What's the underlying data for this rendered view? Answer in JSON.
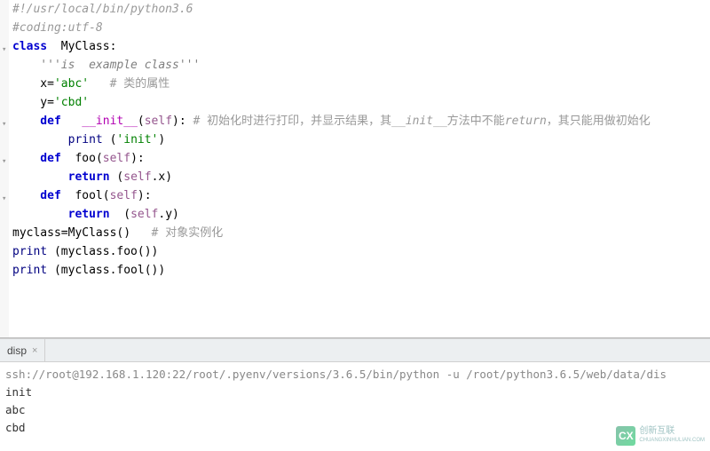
{
  "code": {
    "l1_shebang": "#!/usr/local/bin/python3.6",
    "l2_coding": "#coding:utf-8",
    "l3_class_kw": "class",
    "l3_class_name": "  MyClass:",
    "l4_docstring": "    '''is  example class'''",
    "l5_indent": "    x=",
    "l5_str": "'abc'",
    "l5_comment": "   # 类的属性",
    "l6_indent": "    y=",
    "l6_str": "'cbd'",
    "l7_def": "    def",
    "l7_name": "   __init__",
    "l7_paren_open": "(",
    "l7_self": "self",
    "l7_paren_close": "): ",
    "l7_comment_a": "# 初始化时进行打印，并显示结果，其",
    "l7_comment_b": "__init__",
    "l7_comment_c": "方法中不能",
    "l7_comment_d": "return",
    "l7_comment_e": "，其只能用做初始化",
    "l8_indent": "        ",
    "l8_print": "print ",
    "l8_paren_open": "(",
    "l8_str": "'init'",
    "l8_paren_close": ")",
    "l9_def": "    def",
    "l9_name": "  foo",
    "l9_paren_open": "(",
    "l9_self": "self",
    "l9_paren_close": "):",
    "l10_indent": "        ",
    "l10_return": "return",
    "l10_open": " (",
    "l10_self": "self",
    "l10_attr": ".x)",
    "l11_def": "    def",
    "l11_name": "  fool",
    "l11_paren_open": "(",
    "l11_self": "self",
    "l11_paren_close": "):",
    "l12_indent": "        ",
    "l12_return": "return",
    "l12_open": "  (",
    "l12_self": "self",
    "l12_attr": ".y)",
    "l13_a": "myclass=MyClass()   ",
    "l13_comment": "# 对象实例化",
    "l14_print": "print ",
    "l14_rest": "(myclass.foo())",
    "l15_print": "print ",
    "l15_rest": "(myclass.fool())"
  },
  "tab": {
    "name": "disp",
    "close": "×"
  },
  "console": {
    "ssh": "ssh://root@192.168.1.120:22/root/.pyenv/versions/3.6.5/bin/python -u /root/python3.6.5/web/data/dis",
    "out1": "init",
    "out2": "abc",
    "out3": "cbd"
  },
  "watermark": {
    "logo": "CX",
    "line1": "创新互联",
    "line2": "CHUANGXINHULIAN.COM"
  }
}
